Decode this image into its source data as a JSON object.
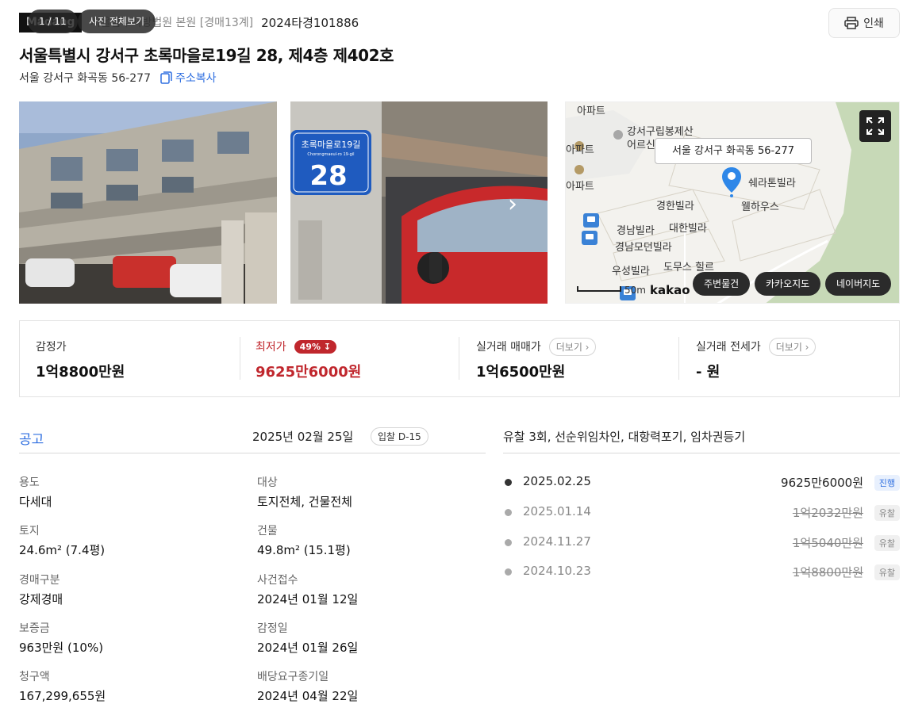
{
  "header": {
    "brand": "Madang",
    "court": "서울남부지방법원 본원 [경매13계]",
    "case_no": "2024타경101886",
    "print_label": "인쇄"
  },
  "title": "서울특별시 강서구 초록마을로19길 28, 제4층 제402호",
  "address": {
    "jibun": "서울 강서구 화곡동 56-277",
    "copy_label": "주소복사"
  },
  "gallery": {
    "counter": "1 / 11",
    "view_all": "사진 전체보기",
    "sign_road": "초록마을로19길",
    "sign_road_en": "Chorongmaeul-ro 19-gil",
    "sign_number": "28"
  },
  "map": {
    "popup": "서울 강서구 화곡동 56-277",
    "labels": [
      "아파트",
      "강서구립봉제산",
      "어르신",
      "아파트",
      "쉐라톤빌라",
      "웰하우스",
      "경한빌라",
      "대한빌라",
      "경남빌라",
      "경남모던빌라",
      "우성빌라",
      "도무스 힐르",
      "아파트"
    ],
    "scale": "50m",
    "logo": "kakao",
    "buttons": [
      "주변물건",
      "카카오지도",
      "네이버지도"
    ]
  },
  "prices": {
    "appraisal": {
      "label": "감정가",
      "value": "1억8800만원"
    },
    "minimum": {
      "label": "최저가",
      "rate": "49%",
      "value": "9625만6000원"
    },
    "sale_real": {
      "label": "실거래 매매가",
      "more": "더보기",
      "value": "1억6500만원"
    },
    "jeonse_real": {
      "label": "실거래 전세가",
      "more": "더보기",
      "value": "- 원"
    }
  },
  "notice": {
    "title": "공고",
    "date": "2025년 02월 25일",
    "dday": "입찰 D-15"
  },
  "fields": [
    {
      "label": "용도",
      "value": "다세대"
    },
    {
      "label": "대상",
      "value": "토지전체, 건물전체"
    },
    {
      "label": "토지",
      "value": "24.6m² (7.4평)"
    },
    {
      "label": "건물",
      "value": "49.8m² (15.1평)"
    },
    {
      "label": "경매구분",
      "value": "강제경매"
    },
    {
      "label": "사건접수",
      "value": "2024년 01월 12일"
    },
    {
      "label": "보증금",
      "value": "963만원 (10%)"
    },
    {
      "label": "감정일",
      "value": "2024년 01월 26일"
    },
    {
      "label": "청구액",
      "value": "167,299,655원"
    },
    {
      "label": "배당요구종기일",
      "value": "2024년 04월 22일"
    }
  ],
  "history": {
    "summary": "유찰 3회, 선순위임차인, 대항력포기, 임차권등기",
    "rows": [
      {
        "date": "2025.02.25",
        "price": "9625만6000원",
        "status": "진행"
      },
      {
        "date": "2025.01.14",
        "price": "1억2032만원",
        "status": "유찰"
      },
      {
        "date": "2024.11.27",
        "price": "1억5040만원",
        "status": "유찰"
      },
      {
        "date": "2024.10.23",
        "price": "1억8800만원",
        "status": "유찰"
      }
    ]
  }
}
